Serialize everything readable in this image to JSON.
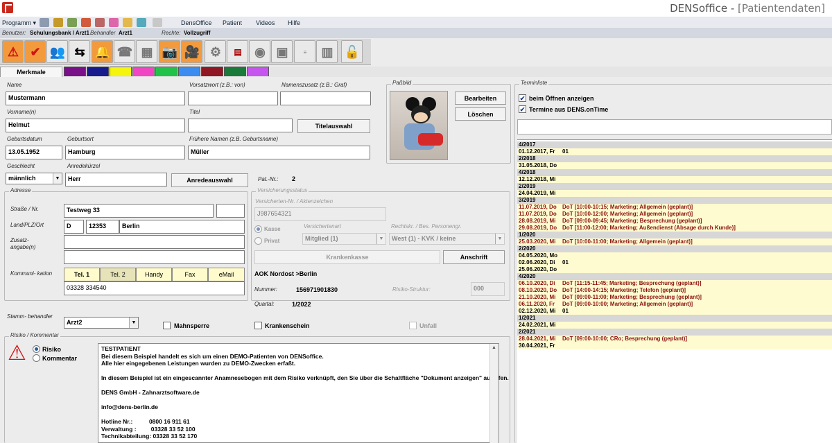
{
  "window": {
    "title": "DENSoffice - ",
    "subtitle": "[Patientendaten]"
  },
  "menu": {
    "programm": "Programm",
    "densoffice": "DensOffice",
    "patient": "Patient",
    "videos": "Videos",
    "hilfe": "Hilfe"
  },
  "userbar": {
    "benutzer_label": "Benutzer:",
    "benutzer": "Schulungsbank / Arzt1",
    "behandler_label": "Behandler",
    "behandler": "Arzt1",
    "rechte_label": "Rechte:",
    "rechte": "Vollzugriff"
  },
  "tabs": {
    "merkmale": "Merkmale",
    "colors": [
      "#7a0f8a",
      "#1a1a8f",
      "#f4f40c",
      "#f046c4",
      "#22c24a",
      "#3a8cf0",
      "#8f1622",
      "#1a7a3a",
      "#c655f0"
    ]
  },
  "labels": {
    "name": "Name",
    "vorsatzwort": "Vorsatzwort (z.B.: von)",
    "namenszusatz": "Namenszusatz (z.B.: Graf)",
    "vorname": "Vorname(n)",
    "titel": "Titel",
    "geburtsdatum": "Geburtsdatum",
    "geburtsort": "Geburtsort",
    "fruehere_namen": "Frühere Namen (z.B. Geburtsname)",
    "geschlecht": "Geschlecht",
    "anredekuerzel": "Anredekürzel",
    "patnr": "Pat.-Nr.:",
    "adresse": "Adresse",
    "strasse": "Straße / Nr.",
    "plz": "Land/PLZ/Ort",
    "zusatz": "Zusatz-\nangabe(n)",
    "kommunikation": "Kommuni- kation",
    "stammbehandler": "Stamm- behandler",
    "risiko_kommentar": "Risiko / Kommentar",
    "passbild": "Paßbild",
    "versicherung": "Versicherungsstatus",
    "versnr": "Versicherten-Nr. / Aktenzeichen",
    "versart": "Versichertenart",
    "rechtskr": "Rechtskr. / Bes. Personengr.",
    "nummer": "Nummer:",
    "risikostruktur": "Risiko-Struktur:",
    "quartal": "Quartal:",
    "terminliste": "Terminliste"
  },
  "patient": {
    "name": "Mustermann",
    "vorsatzwort": "",
    "namenszusatz": "",
    "vorname": "Helmut",
    "titel": "",
    "geburtsdatum": "13.05.1952",
    "geburtsort": "Hamburg",
    "fruehere_namen": "Müller",
    "geschlecht": "männlich",
    "anrede": "Herr",
    "patnr": "2",
    "strasse": "Testweg 33",
    "land": "D",
    "plz": "12353",
    "ort": "Berlin",
    "telefon": "03328 334540",
    "stammbehandler": "Arzt2"
  },
  "buttons": {
    "bearbeiten": "Bearbeiten",
    "loeschen": "Löschen",
    "titelauswahl": "Titelauswahl",
    "anredeauswahl": "Anredeauswahl",
    "krankenkasse": "Krankenkasse",
    "anschrift": "Anschrift"
  },
  "kommtabs": [
    "Tel. 1",
    "Tel. 2",
    "Handy",
    "Fax",
    "eMail"
  ],
  "versicherung": {
    "versnr": "J987654321",
    "kasse": "Kasse",
    "privat": "Privat",
    "versart": "Mitglied (1)",
    "rechtskr": "West (1) - KVK / keine",
    "kassename": "AOK Nordost >Berlin",
    "nummer": "156971901830",
    "risikostruktur": "000",
    "quartal": "1/2022"
  },
  "checkboxes": {
    "mahnsperre": "Mahnsperre",
    "krankenschein": "Krankenschein",
    "unfall": "Unfall",
    "beim_oeffnen": "beim Öffnen anzeigen",
    "dens_ontime": "Termine aus DENS.onTime"
  },
  "risiko": {
    "risiko": "Risiko",
    "kommentar": "Kommentar",
    "text": "TESTPATIENT\nBei diesem Beispiel handelt es sich um einen DEMO-Patienten von DENSoffice.\nAlle hier eingegebenen Leistungen wurden zu DEMO-Zwecken erfaßt.\n\nIn diesem Beispiel ist ein eingescannter Anamnesebogen mit dem Risiko verknüpft, den Sie über die Schaltfläche \"Dokument anzeigen\" aufrufen.\n\nDENS GmbH - Zahnarztsoftware.de\n\ninfo@dens-berlin.de\n\nHotline Nr.:          0800 16 911 61\nVerwaltung :         03328 33 52 100\nTechnikabteilung: 03328 33 52 170"
  },
  "termine": [
    {
      "d": "4/2017",
      "t": "",
      "k": "grp"
    },
    {
      "d": "01.12.2017, Fr",
      "t": "01",
      "k": "yel"
    },
    {
      "d": "2/2018",
      "t": "",
      "k": "grp"
    },
    {
      "d": "31.05.2018, Do",
      "t": "",
      "k": "yel"
    },
    {
      "d": "4/2018",
      "t": "",
      "k": "grp"
    },
    {
      "d": "12.12.2018, Mi",
      "t": "",
      "k": "yel"
    },
    {
      "d": "2/2019",
      "t": "",
      "k": "grp"
    },
    {
      "d": "24.04.2019, Mi",
      "t": "",
      "k": "yel"
    },
    {
      "d": "3/2019",
      "t": "",
      "k": "grp"
    },
    {
      "d": "11.07.2019, Do",
      "t": "DoT [10:00-10:15; Marketing; Allgemein (geplant)]",
      "k": "red"
    },
    {
      "d": "11.07.2019, Do",
      "t": "DoT [10:00-12:00; Marketing; Allgemein (geplant)]",
      "k": "red"
    },
    {
      "d": "28.08.2019, Mi",
      "t": "DoT [09:00-09:45; Marketing; Besprechung (geplant)]",
      "k": "red"
    },
    {
      "d": "29.08.2019, Do",
      "t": "DoT [11:00-12:00; Marketing; Außendienst (Absage durch Kunde)]",
      "k": "red"
    },
    {
      "d": "1/2020",
      "t": "",
      "k": "grp"
    },
    {
      "d": "25.03.2020, Mi",
      "t": "DoT [10:00-11:00; Marketing; Allgemein (geplant)]",
      "k": "red"
    },
    {
      "d": "2/2020",
      "t": "",
      "k": "grp"
    },
    {
      "d": "04.05.2020, Mo",
      "t": "",
      "k": "yel"
    },
    {
      "d": "02.06.2020, Di",
      "t": "01",
      "k": "yel"
    },
    {
      "d": "25.06.2020, Do",
      "t": "",
      "k": "yel"
    },
    {
      "d": "4/2020",
      "t": "",
      "k": "grp"
    },
    {
      "d": "06.10.2020, Di",
      "t": "DoT [11:15-11:45; Marketing; Besprechung (geplant)]",
      "k": "red"
    },
    {
      "d": "08.10.2020, Do",
      "t": "DoT [14:00-14:15; Marketing; Telefon (geplant)]",
      "k": "red"
    },
    {
      "d": "21.10.2020, Mi",
      "t": "DoT [09:00-11:00; Marketing; Besprechung (geplant)]",
      "k": "red"
    },
    {
      "d": "06.11.2020, Fr",
      "t": "DoT [09:00-10:00; Marketing; Allgemein (geplant)]",
      "k": "red"
    },
    {
      "d": "02.12.2020, Mi",
      "t": "01",
      "k": "yel"
    },
    {
      "d": "1/2021",
      "t": "",
      "k": "grp"
    },
    {
      "d": "24.02.2021, Mi",
      "t": "",
      "k": "yel"
    },
    {
      "d": "2/2021",
      "t": "",
      "k": "grp"
    },
    {
      "d": "28.04.2021, Mi",
      "t": "DoT [09:00-10:00; CRo; Besprechung (geplant)]",
      "k": "red"
    },
    {
      "d": "30.04.2021, Fr",
      "t": "",
      "k": "yel"
    }
  ]
}
